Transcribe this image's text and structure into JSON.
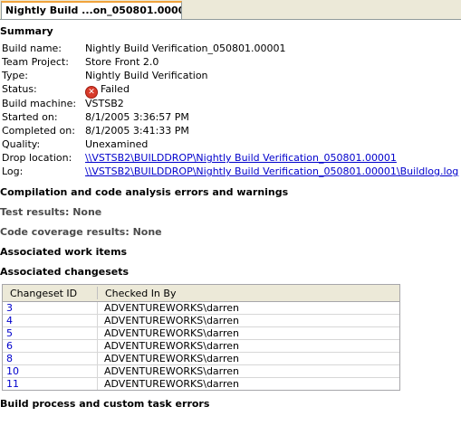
{
  "tab": {
    "title": "Nightly Build ...on_050801.00001"
  },
  "summary": {
    "heading": "Summary",
    "fields": [
      {
        "label": "Build name:",
        "value": "Nightly Build Verification_050801.00001"
      },
      {
        "label": "Team Project:",
        "value": "Store Front 2.0"
      },
      {
        "label": "Type:",
        "value": "Nightly Build Verification"
      },
      {
        "label": "Status:",
        "value": "Failed",
        "icon": "failed-icon"
      },
      {
        "label": "Build machine:",
        "value": "VSTSB2"
      },
      {
        "label": "Started on:",
        "value": "8/1/2005 3:36:57 PM"
      },
      {
        "label": "Completed on:",
        "value": "8/1/2005 3:41:33 PM"
      },
      {
        "label": "Quality:",
        "value": "Unexamined"
      },
      {
        "label": "Drop location:",
        "value": "\\\\VSTSB2\\BUILDDROP\\Nightly Build Verification_050801.00001"
      },
      {
        "label": "Log:",
        "value": "\\\\VSTSB2\\BUILDDROP\\Nightly Build Verification_050801.00001\\Buildlog.log"
      }
    ]
  },
  "sections": {
    "compilation": "Compilation and code analysis errors and warnings",
    "test_results": "Test results: None",
    "code_coverage": "Code coverage results: None",
    "work_items": "Associated work items",
    "changesets": "Associated changesets",
    "build_process": "Build process and custom task errors"
  },
  "changesets": {
    "columns": [
      "Changeset ID",
      "Checked In By"
    ],
    "rows": [
      {
        "id": "3",
        "by": "ADVENTUREWORKS\\darren"
      },
      {
        "id": "4",
        "by": "ADVENTUREWORKS\\darren"
      },
      {
        "id": "5",
        "by": "ADVENTUREWORKS\\darren"
      },
      {
        "id": "6",
        "by": "ADVENTUREWORKS\\darren"
      },
      {
        "id": "8",
        "by": "ADVENTUREWORKS\\darren"
      },
      {
        "id": "10",
        "by": "ADVENTUREWORKS\\darren"
      },
      {
        "id": "11",
        "by": "ADVENTUREWORKS\\darren"
      }
    ]
  },
  "colors": {
    "link": "#0000cc",
    "fail": "#d83a2a",
    "tab_accent": "#f0a33c"
  }
}
